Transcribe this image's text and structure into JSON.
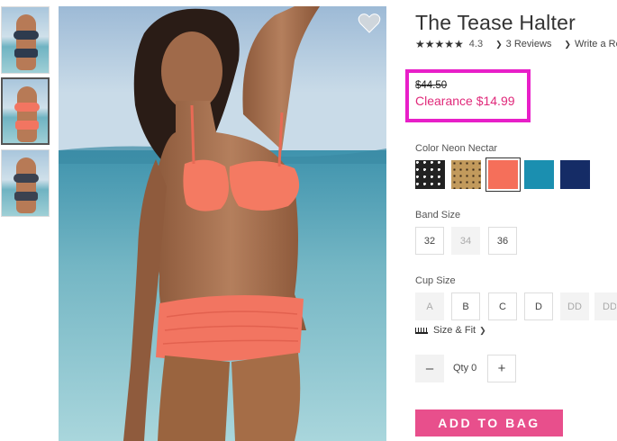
{
  "product": {
    "title": "The Tease Halter",
    "rating_stars": "★★★★★",
    "rating_value": "4.3",
    "reviews_link": "3 Reviews",
    "write_review_link": "Write a Re"
  },
  "price": {
    "original": "$44.50",
    "clearance": "Clearance $14.99",
    "highlight_color": "#e81fc8"
  },
  "color": {
    "label": "Color Neon Nectar",
    "swatches": [
      {
        "name": "black-white print",
        "color": "#222222"
      },
      {
        "name": "leopard",
        "color": "#c29a5c"
      },
      {
        "name": "neon nectar",
        "color": "#f56f5a",
        "selected": true
      },
      {
        "name": "teal",
        "color": "#1b8fb0"
      },
      {
        "name": "navy",
        "color": "#152c66"
      }
    ]
  },
  "band_size": {
    "label": "Band Size",
    "options": [
      {
        "label": "32",
        "available": true
      },
      {
        "label": "34",
        "available": false
      },
      {
        "label": "36",
        "available": true
      }
    ]
  },
  "cup_size": {
    "label": "Cup Size",
    "options": [
      {
        "label": "A",
        "available": false
      },
      {
        "label": "B",
        "available": true
      },
      {
        "label": "C",
        "available": true
      },
      {
        "label": "D",
        "available": true
      },
      {
        "label": "DD",
        "available": false
      },
      {
        "label": "DD",
        "available": false
      }
    ]
  },
  "size_fit": {
    "label": "Size & Fit",
    "icon": "ruler-icon"
  },
  "quantity": {
    "label": "Qty 0",
    "minus": "–",
    "plus": "+"
  },
  "cta": {
    "add_to_bag": "ADD TO BAG",
    "color": "#e84f8c"
  },
  "icons": {
    "wishlist": "heart-icon"
  }
}
